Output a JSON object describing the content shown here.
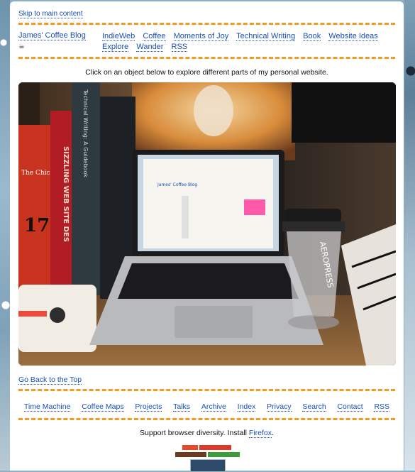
{
  "skip_link": "Skip to main content",
  "site_title": "James' Coffee Blog",
  "nav_items": [
    "IndieWeb",
    "Coffee",
    "Moments of Joy",
    "Technical Writing",
    "Book",
    "Website Ideas",
    "Explore",
    "Wander",
    "RSS"
  ],
  "intro_text": "Click on an object below to explore different parts of my personal website.",
  "back_to_top": "Go Back to the Top",
  "footer_links": [
    "Time Machine",
    "Coffee Maps",
    "Projects",
    "Talks",
    "Archive",
    "Index",
    "Privacy",
    "Search",
    "Contact",
    "RSS"
  ],
  "support": {
    "prefix": "Support browser diversity. Install ",
    "link": "Firefox",
    "suffix": "."
  },
  "photo": {
    "book_title": "The Chicago Manual of Style",
    "book_edition": "17",
    "spine_sizzling": "SIZZLING WEB SITE DES",
    "spine_technical": "Technical Writing: A Guidebook",
    "screen_blog_title": "James' Coffee Blog",
    "aeropress": "AEROPRESS"
  },
  "colors": {
    "accent": "#f29a1f",
    "link": "#1a4fb4"
  }
}
